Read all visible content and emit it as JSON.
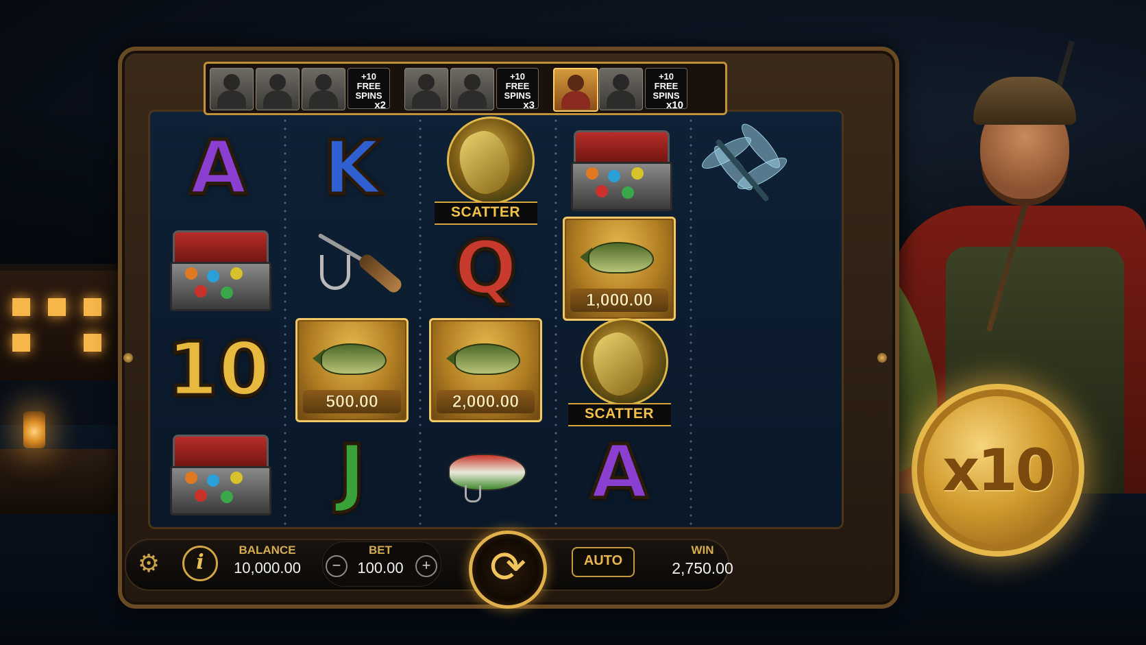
{
  "progress": {
    "cells": [
      {
        "type": "face",
        "active": false
      },
      {
        "type": "face",
        "active": false
      },
      {
        "type": "face",
        "active": false
      },
      {
        "type": "bonus",
        "line1": "+10",
        "line2": "FREE",
        "line3": "SPINS",
        "mult": "x2"
      },
      {
        "type": "face",
        "active": false
      },
      {
        "type": "face",
        "active": false
      },
      {
        "type": "bonus",
        "line1": "+10",
        "line2": "FREE",
        "line3": "SPINS",
        "mult": "x3"
      },
      {
        "type": "face",
        "active": true
      },
      {
        "type": "face",
        "active": false
      },
      {
        "type": "bonus",
        "line1": "+10",
        "line2": "FREE",
        "line3": "SPINS",
        "mult": "x10"
      }
    ]
  },
  "reels": [
    [
      {
        "kind": "letter",
        "text": "A",
        "color": "#8a3fd0"
      },
      {
        "kind": "tackle"
      },
      {
        "kind": "letter",
        "text": "10",
        "color": "#e7b93e"
      },
      {
        "kind": "tackle"
      }
    ],
    [
      {
        "kind": "letter",
        "text": "K",
        "color": "#2f5fd0"
      },
      {
        "kind": "rod"
      },
      {
        "kind": "cash",
        "value": "500.00"
      },
      {
        "kind": "letter",
        "text": "J",
        "color": "#3aa23a"
      }
    ],
    [
      {
        "kind": "scatter",
        "label": "SCATTER"
      },
      {
        "kind": "letter",
        "text": "Q",
        "color": "#c8392e"
      },
      {
        "kind": "cash",
        "value": "2,000.00"
      },
      {
        "kind": "lure"
      }
    ],
    [
      {
        "kind": "tackle"
      },
      {
        "kind": "cash",
        "value": "1,000.00"
      },
      {
        "kind": "scatter",
        "label": "SCATTER"
      },
      {
        "kind": "letter",
        "text": "A",
        "color": "#8a3fd0"
      }
    ],
    [
      {
        "kind": "dragonfly"
      }
    ]
  ],
  "controls": {
    "settings_icon": "gear-icon",
    "info_icon": "info-icon",
    "info_glyph": "i",
    "balance_label": "BALANCE",
    "balance_value": "10,000.00",
    "bet_label": "BET",
    "bet_value": "100.00",
    "minus": "−",
    "plus": "+",
    "spin_glyph": "⟳",
    "auto_label": "AUTO",
    "win_label": "WIN",
    "win_value": "2,750.00"
  },
  "multiplier_coin": "x10"
}
